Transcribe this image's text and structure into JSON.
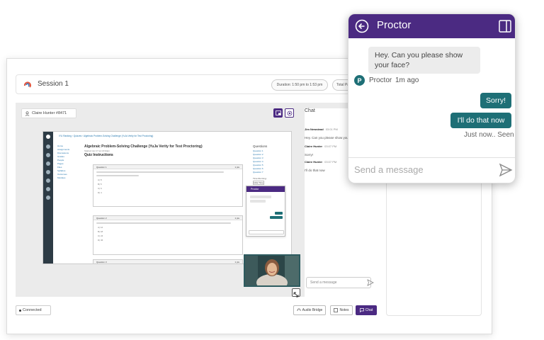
{
  "session": {
    "title": "Session 1",
    "duration_pill": "Duration: 1:50 pm to 1:53 pm",
    "total_pill": "Total Pa"
  },
  "student": {
    "name": "Claire Hunter #8471"
  },
  "lms": {
    "breadcrumb": "IYU Ranking  ›  Quizzes  ›  Algebraic Problem-Solving Challenge (YuJa Verity for Test Proctoring)",
    "quiz_title": "Algebraic Problem-Solving Challenge (YuJa Verity for Test Proctoring)",
    "meta": "Started: Apr 17 at 10:34am",
    "instructions": "Quiz Instructions",
    "nav_links": [
      "Home",
      "Assignments",
      "Discussions",
      "Grades",
      "People",
      "Pages",
      "Files",
      "Syllabus",
      "Outcomes",
      "Modules"
    ],
    "questions": [
      {
        "label": "Question 1",
        "pts": "1 pts",
        "options": [
          "A) 8",
          "B) 5",
          "C) 6",
          "D) 4"
        ]
      },
      {
        "label": "Question 2",
        "pts": "1 pts",
        "options": [
          "A) 12",
          "B) 18",
          "C) 24",
          "D) 36"
        ]
      },
      {
        "label": "Question 3",
        "pts": "1 pts"
      }
    ],
    "side_title": "Questions",
    "side_list": [
      "Question 1",
      "Question 2",
      "Question 3",
      "Question 4",
      "Question 5",
      "Question 6",
      "Question 7"
    ],
    "time_running": "Time Running:",
    "hide_time": "Hide Time",
    "mini_proctor": "Proctor"
  },
  "chat_panel": {
    "title": "Chat",
    "messages": [
      {
        "name": "Jim Newstead",
        "time": "03:01 PM",
        "text": "Hey. Can you please show your face?"
      },
      {
        "name": "Claire Hunter",
        "time": "03:07 PM",
        "text": "Sorry!"
      },
      {
        "name": "Claire Hunter",
        "time": "03:07 PM",
        "text": "I'll do that now"
      }
    ],
    "input_placeholder": "Send a message"
  },
  "footer": {
    "connected": "Connected",
    "audio_bridge": "Audio Bridge",
    "notes": "Notes",
    "chat": "Chat"
  },
  "proctor_popup": {
    "title": "Proctor",
    "incoming": "Hey. Can you please show your face?",
    "sender": "Proctor",
    "sender_time": "1m ago",
    "avatar_letter": "P",
    "outgoing": [
      "Sorry!",
      "I'll do that now"
    ],
    "status": "Just now.. Seen",
    "input_placeholder": "Send a message"
  },
  "colors": {
    "proctor_purple": "#4b2a82",
    "reply_teal": "#1e6f76"
  }
}
